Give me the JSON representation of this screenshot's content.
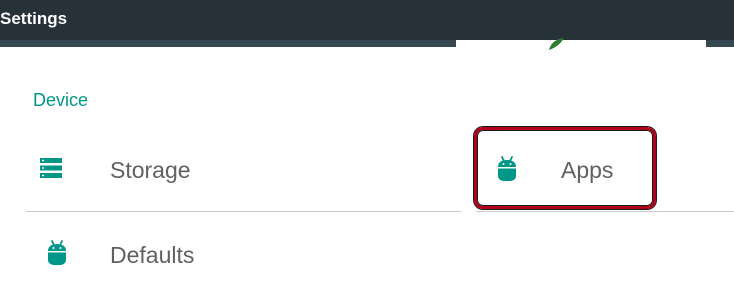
{
  "header": {
    "title": "Settings"
  },
  "section": {
    "title": "Device"
  },
  "items": [
    {
      "label": "Storage",
      "icon": "storage-icon"
    },
    {
      "label": "Apps",
      "icon": "android-icon"
    },
    {
      "label": "Defaults",
      "icon": "android-icon"
    }
  ],
  "colors": {
    "topbar": "#263238",
    "accent": "#009688",
    "highlight": "#b0001a",
    "text": "#616161"
  }
}
